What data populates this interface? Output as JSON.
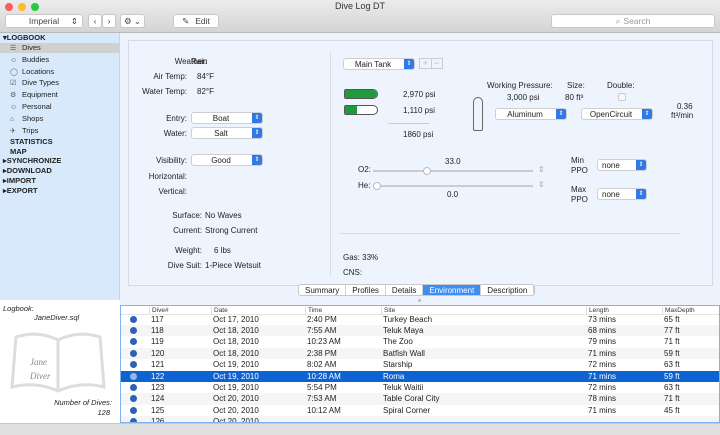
{
  "window": {
    "title": "Dive Log DT"
  },
  "toolbar": {
    "units": "Imperial",
    "back": "‹",
    "forward": "›",
    "gear": "⚙ ⌄",
    "edit_label": "Edit",
    "search_placeholder": "Search"
  },
  "sidebar": {
    "logbook": "LOGBOOK",
    "items": [
      {
        "label": "Dives",
        "icon": "dive-icon"
      },
      {
        "label": "Buddies",
        "icon": "buddies-icon"
      },
      {
        "label": "Locations",
        "icon": "location-icon"
      },
      {
        "label": "Dive Types",
        "icon": "checkbox-icon"
      },
      {
        "label": "Equipment",
        "icon": "equipment-icon"
      },
      {
        "label": "Personal",
        "icon": "person-icon"
      },
      {
        "label": "Shops",
        "icon": "shop-icon"
      },
      {
        "label": "Trips",
        "icon": "plane-icon"
      }
    ],
    "sections": [
      "STATISTICS",
      "MAP",
      "SYNCHRONIZE",
      "DOWNLOAD",
      "IMPORT",
      "EXPORT"
    ]
  },
  "environment": {
    "weather_label": "Weather:",
    "weather": "Rain",
    "air_label": "Air Temp:",
    "air": "84°F",
    "water_temp_label": "Water Temp:",
    "water_temp": "82°F",
    "entry_label": "Entry:",
    "entry": "Boat",
    "water_label": "Water:",
    "water": "Salt",
    "visibility_label": "Visibility:",
    "visibility": "Good",
    "horizontal_label": "Horizontal:",
    "vertical_label": "Vertical:",
    "surface_label": "Surface:",
    "surface": "No Waves",
    "current_label": "Current:",
    "current": "Strong Current",
    "weight_label": "Weight:",
    "weight": "6 lbs",
    "suit_label": "Dive Suit:",
    "suit": "1-Piece Wetsuit"
  },
  "tank": {
    "selector": "Main Tank",
    "add": "+",
    "remove": "−",
    "start_pressure": "2,970 psi",
    "end_pressure": "1,110 psi",
    "used": "1860 psi",
    "start_fill": 0.99,
    "end_fill": 0.37,
    "working_pressure_label": "Working Pressure:",
    "working_pressure": "3,000 psi",
    "size_label": "Size:",
    "size": "80 ft³",
    "double_label": "Double:",
    "double": false,
    "material": "Aluminum",
    "circuit": "OpenCircuit",
    "sac": "0.36",
    "sac_unit": "ft³/min",
    "o2_label": "O2:",
    "o2": "33.0",
    "he_label": "He:",
    "he": "0.0",
    "min_ppo_label1": "Min",
    "min_ppo_label2": "PPO",
    "min_ppo": "none",
    "max_ppo_label1": "Max",
    "max_ppo_label2": "PPO",
    "max_ppo": "none",
    "gas_label": "Gas:",
    "gas": "33%",
    "cns_label": "CNS:"
  },
  "tabs": [
    {
      "label": "Summary"
    },
    {
      "label": "Profiles"
    },
    {
      "label": "Details"
    },
    {
      "label": "Environment",
      "active": true
    },
    {
      "label": "Description"
    }
  ],
  "logbook": {
    "label": "Logbook:",
    "file": "JaneDiver.sql",
    "logo_text": "Jane Diver",
    "count_label": "Number of Dives:",
    "count": "128"
  },
  "table": {
    "columns": [
      "Dive#",
      "Date",
      "Time",
      "Site",
      "Length",
      "MaxDepth"
    ],
    "rows": [
      [
        "117",
        "Oct 17, 2010",
        "2:40 PM",
        "Turkey Beach",
        "73 mins",
        "65 ft"
      ],
      [
        "118",
        "Oct 18, 2010",
        "7:55 AM",
        "Teluk Maya",
        "68 mins",
        "77 ft"
      ],
      [
        "119",
        "Oct 18, 2010",
        "10:23 AM",
        "The Zoo",
        "79 mins",
        "71 ft"
      ],
      [
        "120",
        "Oct 18, 2010",
        "2:38 PM",
        "Batfish Wall",
        "71 mins",
        "59 ft"
      ],
      [
        "121",
        "Oct 19, 2010",
        "8:02 AM",
        "Starship",
        "72 mins",
        "63 ft"
      ],
      [
        "122",
        "Oct 19, 2010",
        "10:28 AM",
        "Roma",
        "71 mins",
        "59 ft"
      ],
      [
        "123",
        "Oct 19, 2010",
        "5:54 PM",
        "Teluk Waitii",
        "72 mins",
        "63 ft"
      ],
      [
        "124",
        "Oct 20, 2010",
        "7:53 AM",
        "Table Coral City",
        "78 mins",
        "71 ft"
      ],
      [
        "125",
        "Oct 20, 2010",
        "10:12 AM",
        "Spiral Corner",
        "71 mins",
        "45 ft"
      ],
      [
        "126",
        "Oct 20, 2010",
        "",
        "",
        "",
        ""
      ]
    ],
    "selected": "122"
  },
  "colors": {
    "accent": "#0e63d2",
    "sidebar": "#d7e9fb",
    "tank_fill": "#1f9a3c"
  }
}
